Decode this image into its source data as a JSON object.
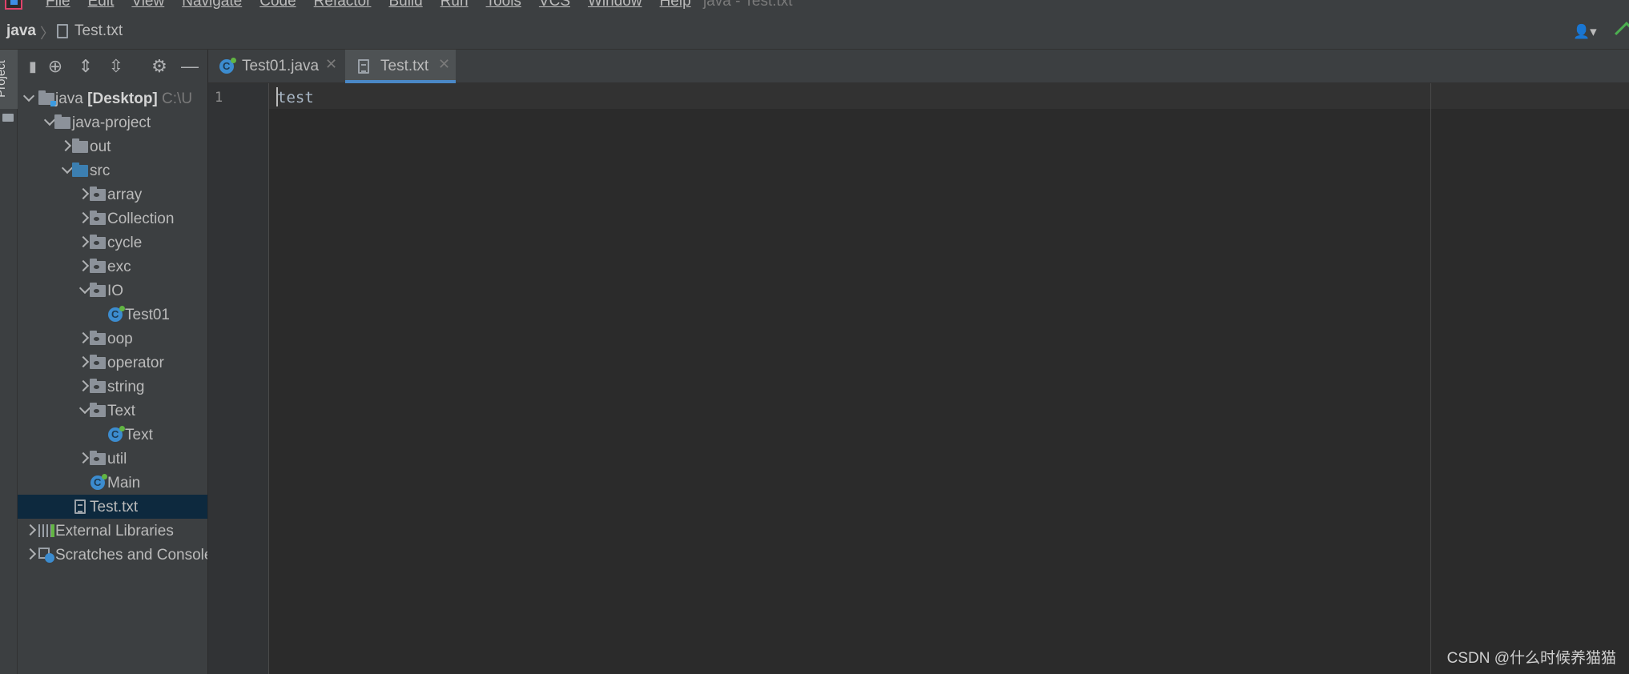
{
  "menubar": {
    "items": [
      "File",
      "Edit",
      "View",
      "Navigate",
      "Code",
      "Refactor",
      "Build",
      "Run",
      "Tools",
      "VCS",
      "Window",
      "Help"
    ],
    "window_title": "java - Test.txt"
  },
  "navbar": {
    "project": "java",
    "file": "Test.txt"
  },
  "tool_window": {
    "label": "Project"
  },
  "tree": {
    "root": {
      "name": "java",
      "qualifier": "[Desktop]",
      "path": "C:\\U"
    },
    "items": [
      {
        "label": "java-project"
      },
      {
        "label": "out"
      },
      {
        "label": "src"
      },
      {
        "label": "array"
      },
      {
        "label": "Collection"
      },
      {
        "label": "cycle"
      },
      {
        "label": "exc"
      },
      {
        "label": "IO"
      },
      {
        "label": "Test01"
      },
      {
        "label": "oop"
      },
      {
        "label": "operator"
      },
      {
        "label": "string"
      },
      {
        "label": "Text"
      },
      {
        "label": "Text"
      },
      {
        "label": "util"
      },
      {
        "label": "Main"
      },
      {
        "label": "Test.txt"
      },
      {
        "label": "External Libraries"
      },
      {
        "label": "Scratches and Consoles"
      }
    ]
  },
  "tabs": [
    {
      "label": "Test01.java",
      "icon": "java-class-icon",
      "active": false
    },
    {
      "label": "Test.txt",
      "icon": "text-file-icon",
      "active": true
    }
  ],
  "editor": {
    "line_number": "1",
    "content": "test"
  },
  "watermark": "CSDN @什么时候养猫猫",
  "colors": {
    "accent": "#4a88c7",
    "selection": "#0d293e",
    "background": "#2b2b2b",
    "panel": "#3c3f41"
  }
}
